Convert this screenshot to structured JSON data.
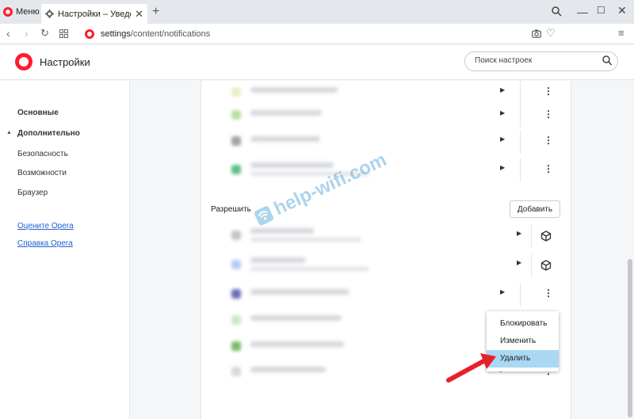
{
  "browser": {
    "menu_label": "Меню",
    "tab_title": "Настройки – Уведомлени",
    "url_host": "settings",
    "url_path": "/content/notifications"
  },
  "settings": {
    "title": "Настройки",
    "search_placeholder": "Поиск настроек"
  },
  "sidebar": {
    "basic": "Основные",
    "advanced": "Дополнительно",
    "items": [
      "Безопасность",
      "Возможности",
      "Браузер"
    ],
    "links": [
      "Оцените Opera",
      "Справка Opera"
    ]
  },
  "content": {
    "allow_label": "Разрешить",
    "add_button": "Добавить"
  },
  "context_menu": {
    "items": [
      "Блокировать",
      "Изменить",
      "Удалить"
    ],
    "active_item": "Удалить"
  },
  "watermark": "help-wifi.com",
  "colors": {
    "opera_red": "#ff1b2d",
    "link_blue": "#1f5fd1",
    "menu_highlight": "#a8d8f3",
    "arrow_red": "#e8202a"
  },
  "icons": {
    "back": "chevron-left-icon",
    "forward": "chevron-right-icon",
    "reload": "reload-icon",
    "speed_dial": "grid-icon",
    "snapshot": "camera-icon",
    "bookmark": "heart-icon",
    "search": "search-icon",
    "extension": "cube-icon",
    "more": "vertical-dots-icon"
  }
}
